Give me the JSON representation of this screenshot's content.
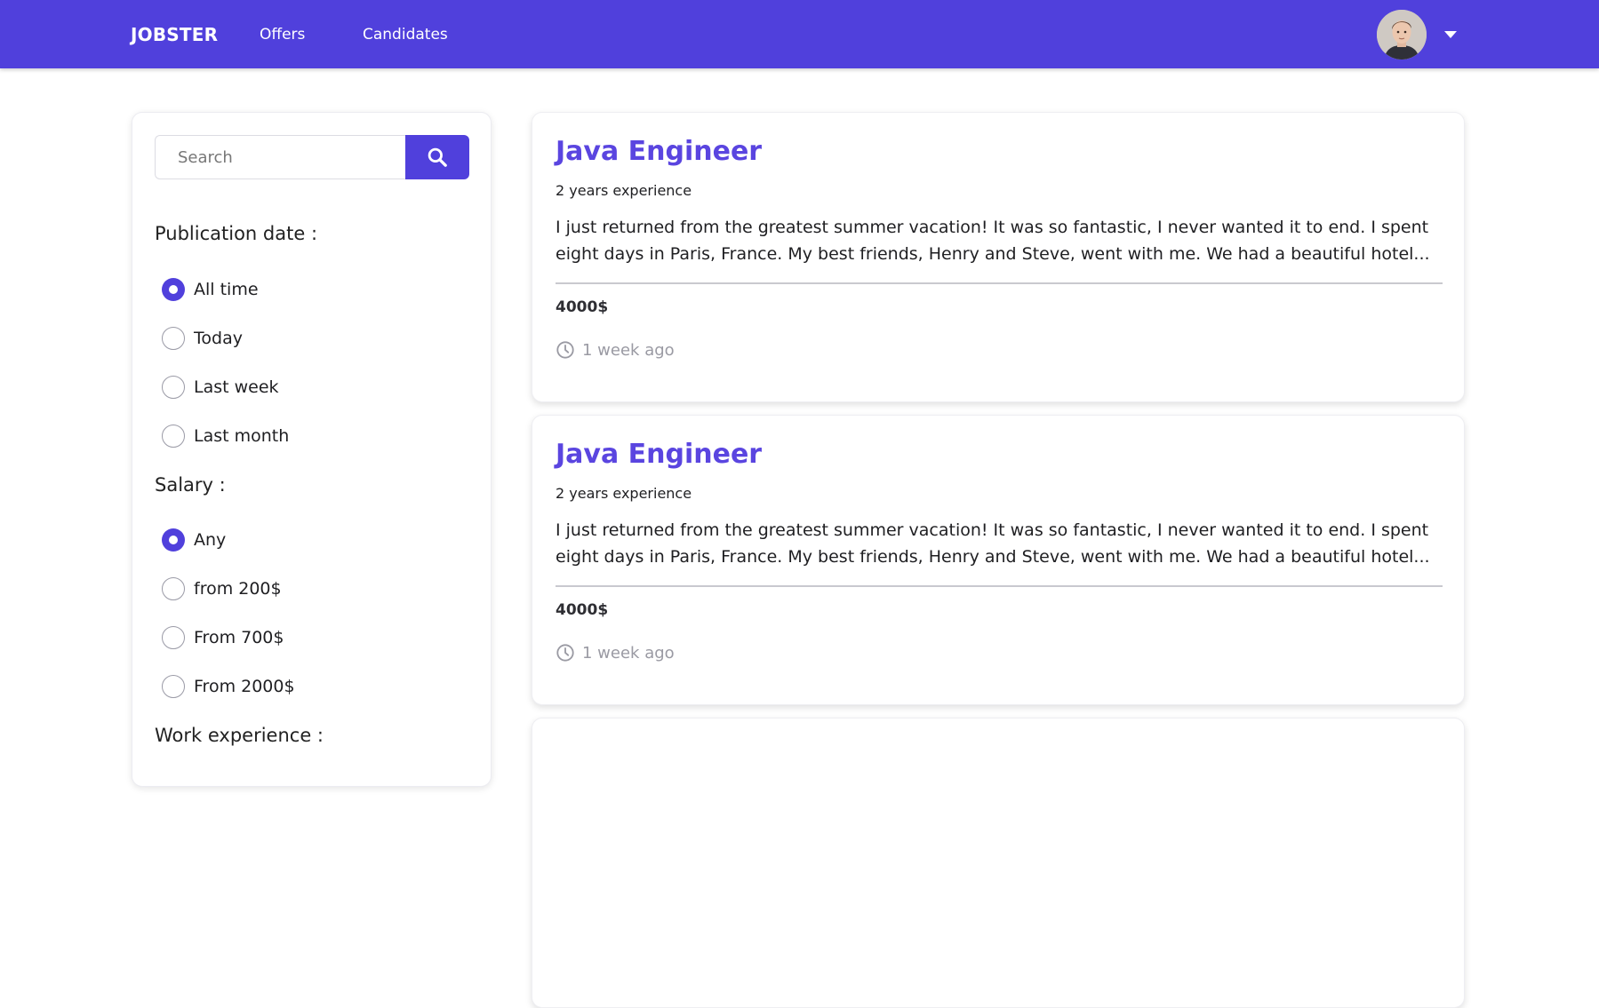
{
  "navbar": {
    "brand": "JOBSTER",
    "links": [
      "Offers",
      "Candidates"
    ],
    "accent_color": "#5040dc",
    "avatar_icon": "user-avatar",
    "menu_icon": "caret-down-icon"
  },
  "sidebar": {
    "search": {
      "placeholder": "Search",
      "value": "",
      "icon": "search-icon"
    },
    "publication_date": {
      "heading": "Publication date :",
      "options": [
        "All time",
        "Today",
        "Last week",
        "Last month"
      ],
      "selected": "All time"
    },
    "salary": {
      "heading": "Salary :",
      "options": [
        "Any",
        "from 200$",
        "From 700$",
        "From 2000$"
      ],
      "selected": "Any"
    },
    "work_experience": {
      "heading": "Work experience :"
    }
  },
  "offers": [
    {
      "title": "Java Engineer",
      "experience": "2 years experience",
      "description": "I just returned from the greatest summer vacation! It was so fantastic, I never wanted it to end. I spent eight days in Paris, France. My best friends, Henry and Steve, went with me. We had a beautiful hotel...",
      "salary": "4000$",
      "posted": "1 week ago"
    },
    {
      "title": "Java Engineer",
      "experience": "2 years experience",
      "description": "I just returned from the greatest summer vacation! It was so fantastic, I never wanted it to end. I spent eight days in Paris, France. My best friends, Henry and Steve, went with me. We had a beautiful hotel...",
      "salary": "4000$",
      "posted": "1 week ago"
    }
  ]
}
